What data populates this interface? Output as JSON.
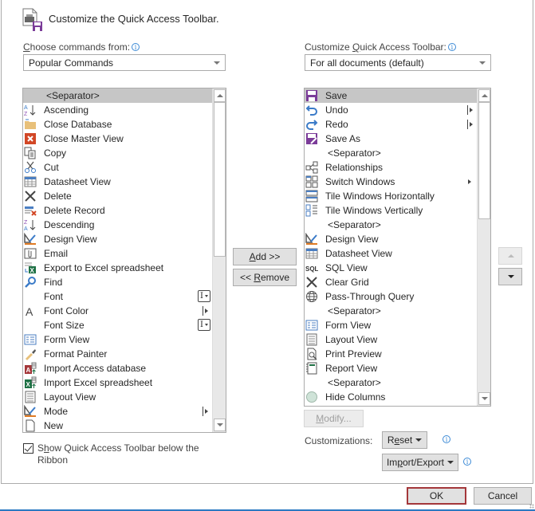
{
  "header": {
    "title": "Customize the Quick Access Toolbar.",
    "icon": "quick-access-toolbar-icon"
  },
  "left": {
    "label_prefix": "",
    "label_accel": "C",
    "label_rest": "hoose commands from:",
    "combo_value": "Popular Commands",
    "items": [
      {
        "label": "<Separator>",
        "icon": "none",
        "separator": true,
        "selected": true
      },
      {
        "label": "Ascending",
        "icon": "sort-ascending-icon"
      },
      {
        "label": "Close Database",
        "icon": "close-database-icon"
      },
      {
        "label": "Close Master View",
        "icon": "close-red-x-icon"
      },
      {
        "label": "Copy",
        "icon": "copy-icon"
      },
      {
        "label": "Cut",
        "icon": "scissors-icon"
      },
      {
        "label": "Datasheet View",
        "icon": "datasheet-icon"
      },
      {
        "label": "Delete",
        "icon": "delete-x-icon"
      },
      {
        "label": "Delete Record",
        "icon": "delete-record-icon"
      },
      {
        "label": "Descending",
        "icon": "sort-descending-icon"
      },
      {
        "label": "Design View",
        "icon": "design-view-icon"
      },
      {
        "label": "Email",
        "icon": "email-attachment-icon"
      },
      {
        "label": "Export to Excel spreadsheet",
        "icon": "export-excel-icon"
      },
      {
        "label": "Find",
        "icon": "magnifier-icon"
      },
      {
        "label": "Font",
        "icon": "none",
        "control": "font-picker"
      },
      {
        "label": "Font Color",
        "icon": "font-color-icon",
        "control": "submenu"
      },
      {
        "label": "Font Size",
        "icon": "none",
        "control": "font-picker"
      },
      {
        "label": "Form View",
        "icon": "form-view-icon"
      },
      {
        "label": "Format Painter",
        "icon": "format-painter-icon"
      },
      {
        "label": "Import Access database",
        "icon": "import-access-icon"
      },
      {
        "label": "Import Excel spreadsheet",
        "icon": "import-excel-icon"
      },
      {
        "label": "Layout View",
        "icon": "layout-view-icon"
      },
      {
        "label": "Mode",
        "icon": "design-view-icon",
        "control": "submenu"
      },
      {
        "label": "New",
        "icon": "new-document-icon"
      }
    ]
  },
  "right": {
    "label_prefix": "Customize ",
    "label_accel": "Q",
    "label_rest": "uick Access Toolbar:",
    "combo_value": "For all documents (default)",
    "items": [
      {
        "label": "Save",
        "icon": "save-icon",
        "selected": true
      },
      {
        "label": "Undo",
        "icon": "undo-icon",
        "control": "submenu"
      },
      {
        "label": "Redo",
        "icon": "redo-icon",
        "control": "submenu"
      },
      {
        "label": "Save As",
        "icon": "save-as-icon"
      },
      {
        "label": "<Separator>",
        "icon": "none",
        "separator": true
      },
      {
        "label": "Relationships",
        "icon": "relationships-icon"
      },
      {
        "label": "Switch Windows",
        "icon": "switch-windows-icon",
        "control": "triangle"
      },
      {
        "label": "Tile Windows Horizontally",
        "icon": "tile-horizontal-icon"
      },
      {
        "label": "Tile Windows Vertically",
        "icon": "tile-vertical-icon"
      },
      {
        "label": "<Separator>",
        "icon": "none",
        "separator": true
      },
      {
        "label": "Design View",
        "icon": "design-view-icon"
      },
      {
        "label": "Datasheet View",
        "icon": "datasheet-icon"
      },
      {
        "label": "SQL View",
        "icon": "sql-icon"
      },
      {
        "label": "Clear Grid",
        "icon": "delete-x-icon"
      },
      {
        "label": "Pass-Through Query",
        "icon": "globe-icon"
      },
      {
        "label": "<Separator>",
        "icon": "none",
        "separator": true
      },
      {
        "label": "Form View",
        "icon": "form-view-icon"
      },
      {
        "label": "Layout View",
        "icon": "layout-view-icon"
      },
      {
        "label": "Print Preview",
        "icon": "print-preview-icon"
      },
      {
        "label": "Report View",
        "icon": "report-view-icon"
      },
      {
        "label": "<Separator>",
        "icon": "none",
        "separator": true
      },
      {
        "label": "Hide Columns",
        "icon": "hide-columns-icon"
      }
    ]
  },
  "buttons": {
    "add_accel": "A",
    "add_rest": "dd >>",
    "remove_prefix": "<< ",
    "remove_accel": "R",
    "remove_rest": "emove",
    "modify_accel": "M",
    "modify_rest": "odify...",
    "move_up": "move-up-icon",
    "move_down": "move-down-icon",
    "customizations_label": "Customizations:",
    "reset_prefix": "R",
    "reset_accel": "e",
    "reset_rest": "set",
    "import_prefix": "Im",
    "import_accel": "p",
    "import_rest": "ort/Export",
    "ok": "OK",
    "cancel": "Cancel"
  },
  "checkbox": {
    "checked": true,
    "label_prefix": "S",
    "label_accel": "h",
    "label_rest": "ow Quick Access Toolbar below the Ribbon"
  },
  "colors": {
    "selection": "#c6c6c6",
    "accent_blue": "#2b79c2",
    "default_button_border": "#a4373a",
    "info_blue": "#3c8ad6"
  }
}
